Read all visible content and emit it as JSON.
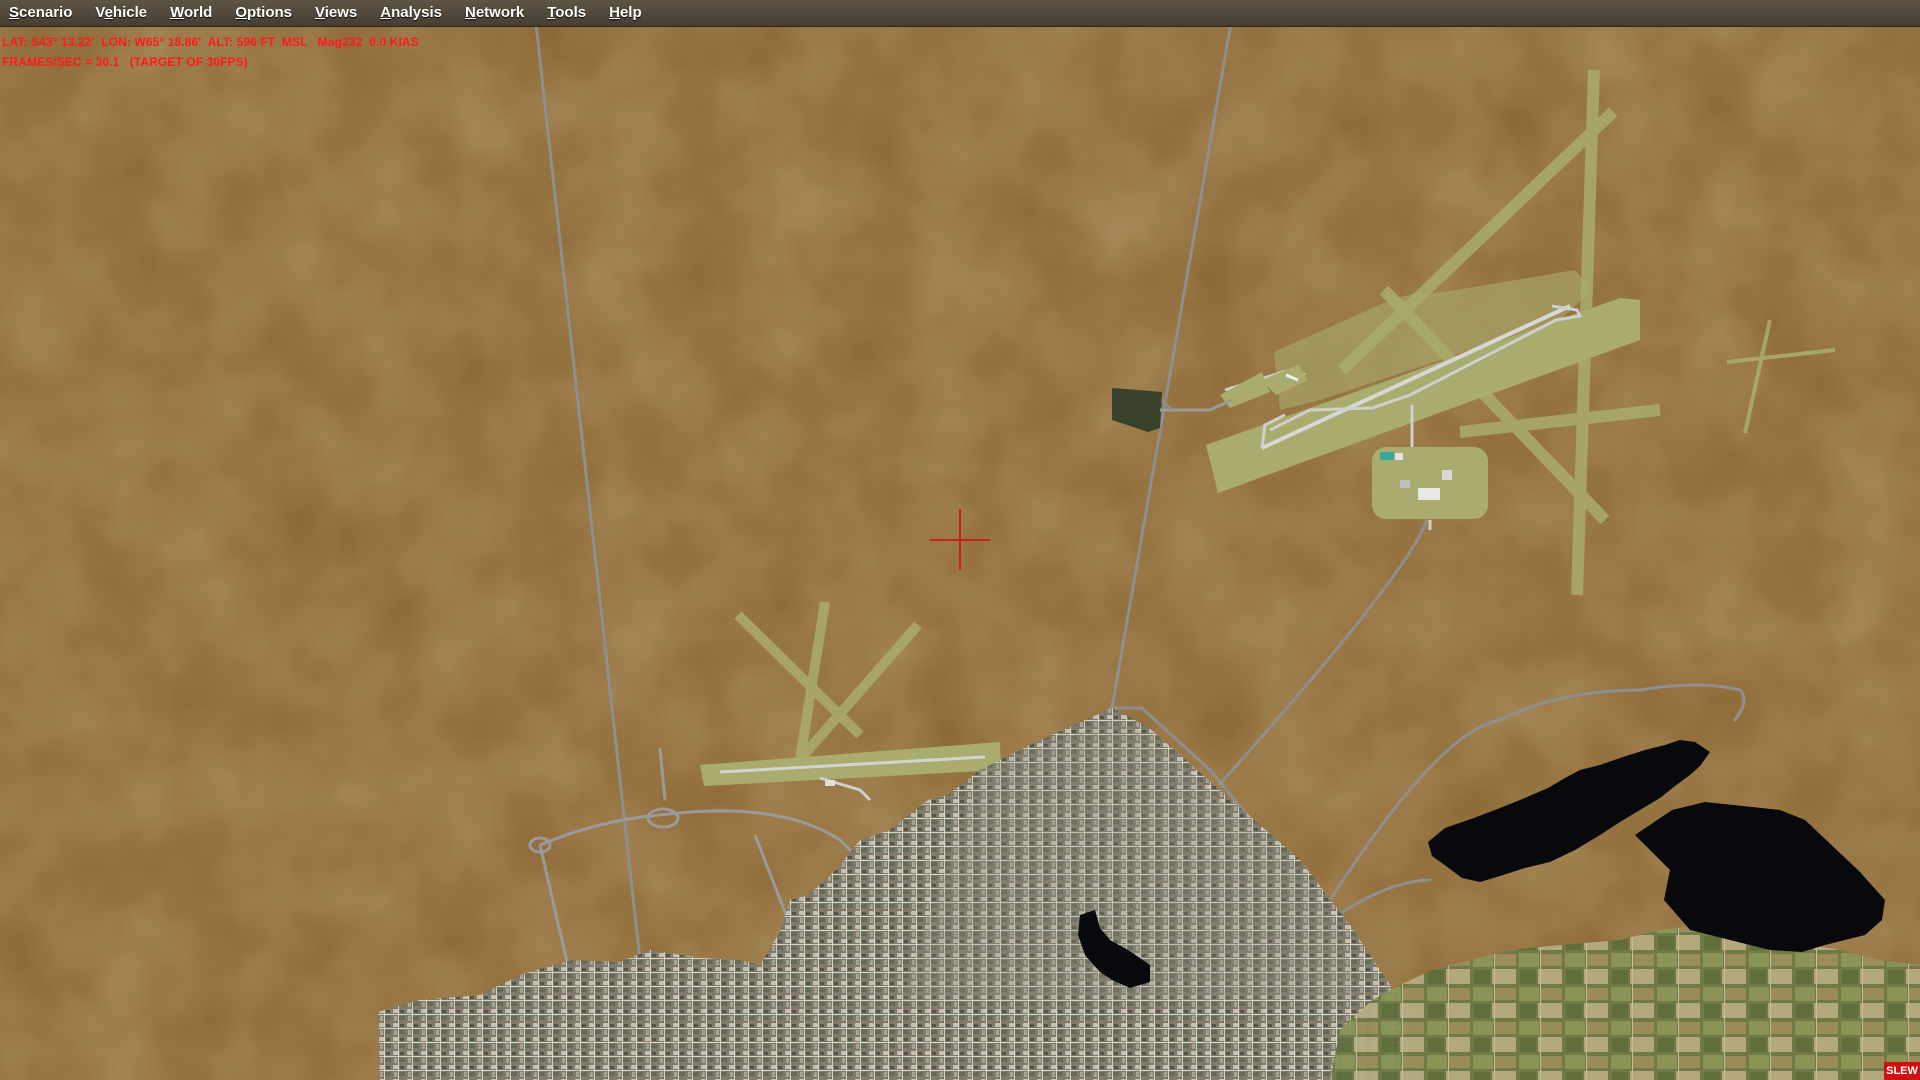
{
  "menubar": {
    "items": [
      {
        "pre": "",
        "mnemonic": "S",
        "post": "cenario"
      },
      {
        "pre": "V",
        "mnemonic": "e",
        "post": "hicle"
      },
      {
        "pre": "",
        "mnemonic": "W",
        "post": "orld"
      },
      {
        "pre": "",
        "mnemonic": "O",
        "post": "ptions"
      },
      {
        "pre": "",
        "mnemonic": "V",
        "post": "iews"
      },
      {
        "pre": "",
        "mnemonic": "A",
        "post": "nalysis"
      },
      {
        "pre": "",
        "mnemonic": "N",
        "post": "etwork"
      },
      {
        "pre": "",
        "mnemonic": "T",
        "post": "ools"
      },
      {
        "pre": "",
        "mnemonic": "H",
        "post": "elp"
      }
    ]
  },
  "hud": {
    "position_line": "LAT: S43° 13.22'  LON: W65° 18.86'  ALT: 596 FT  MSL   Mag232  0.0 KIAS",
    "fps_line": "FRAMES/SEC = 30.1   (TARGET OF 30FPS)"
  },
  "status": {
    "slew": "SLEW"
  },
  "colors": {
    "terrain": "#8a6532",
    "hud_text": "#ff1a1a",
    "crosshair": "#d01818",
    "runway_grass": "#a9ac6e",
    "water": "#06090d",
    "road": "#9a9a9a"
  }
}
